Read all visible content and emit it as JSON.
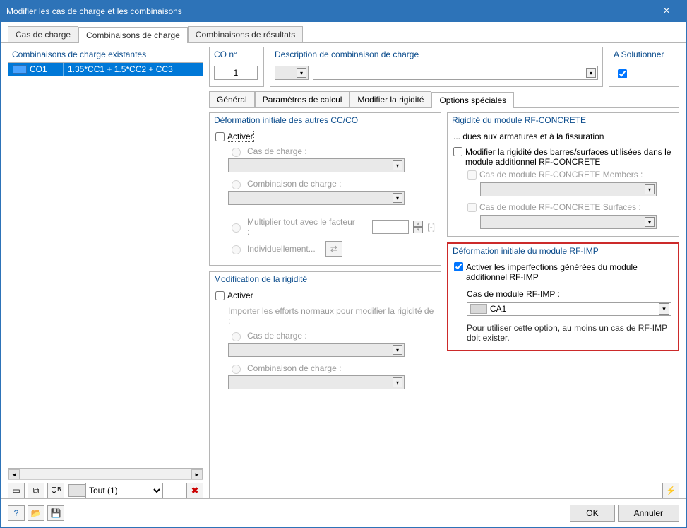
{
  "window": {
    "title": "Modifier les cas de charge et les combinaisons"
  },
  "mainTabs": [
    "Cas de charge",
    "Combinaisons de charge",
    "Combinaisons de résultats"
  ],
  "mainTabActive": 1,
  "left": {
    "header": "Combinaisons de charge existantes",
    "rows": [
      {
        "id": "CO1",
        "desc": "1.35*CC1 + 1.5*CC2 + CC3"
      }
    ],
    "filter": "Tout (1)"
  },
  "top": {
    "coLabel": "CO n°",
    "coValue": "1",
    "descLabel": "Description de combinaison de charge",
    "solveLabel": "A Solutionner"
  },
  "innerTabs": [
    "Général",
    "Paramètres de calcul",
    "Modifier la rigidité",
    "Options spéciales"
  ],
  "innerTabActive": 3,
  "deform": {
    "title": "Déformation initiale des autres CC/CO",
    "activer": "Activer",
    "casCharge": "Cas de charge :",
    "comboCharge": "Combinaison de charge :",
    "multiplier": "Multiplier tout avec le facteur :",
    "indiv": "Individuellement...",
    "unit": "[-]"
  },
  "modif": {
    "title": "Modification de la rigidité",
    "activer": "Activer",
    "hint": "Importer les efforts normaux pour modifier la rigidité de :",
    "casCharge": "Cas de charge :",
    "comboCharge": "Combinaison de charge :"
  },
  "rfcon": {
    "title": "Rigidité du module RF-CONCRETE",
    "sub": "... dues aux armatures et à la fissuration",
    "modLabel": "Modifier la rigidité des barres/surfaces utilisées dans le module additionnel RF-CONCRETE",
    "members": "Cas de module RF-CONCRETE Members :",
    "surfaces": "Cas de module RF-CONCRETE Surfaces :"
  },
  "rfimp": {
    "title": "Déformation initiale du module RF-IMP",
    "activer": "Activer les imperfections générées du module additionnel RF-IMP",
    "casLabel": "Cas de module RF-IMP :",
    "casValue": "CA1",
    "note": "Pour utiliser cette option, au moins un cas de RF-IMP doit exister."
  },
  "buttons": {
    "ok": "OK",
    "cancel": "Annuler"
  }
}
